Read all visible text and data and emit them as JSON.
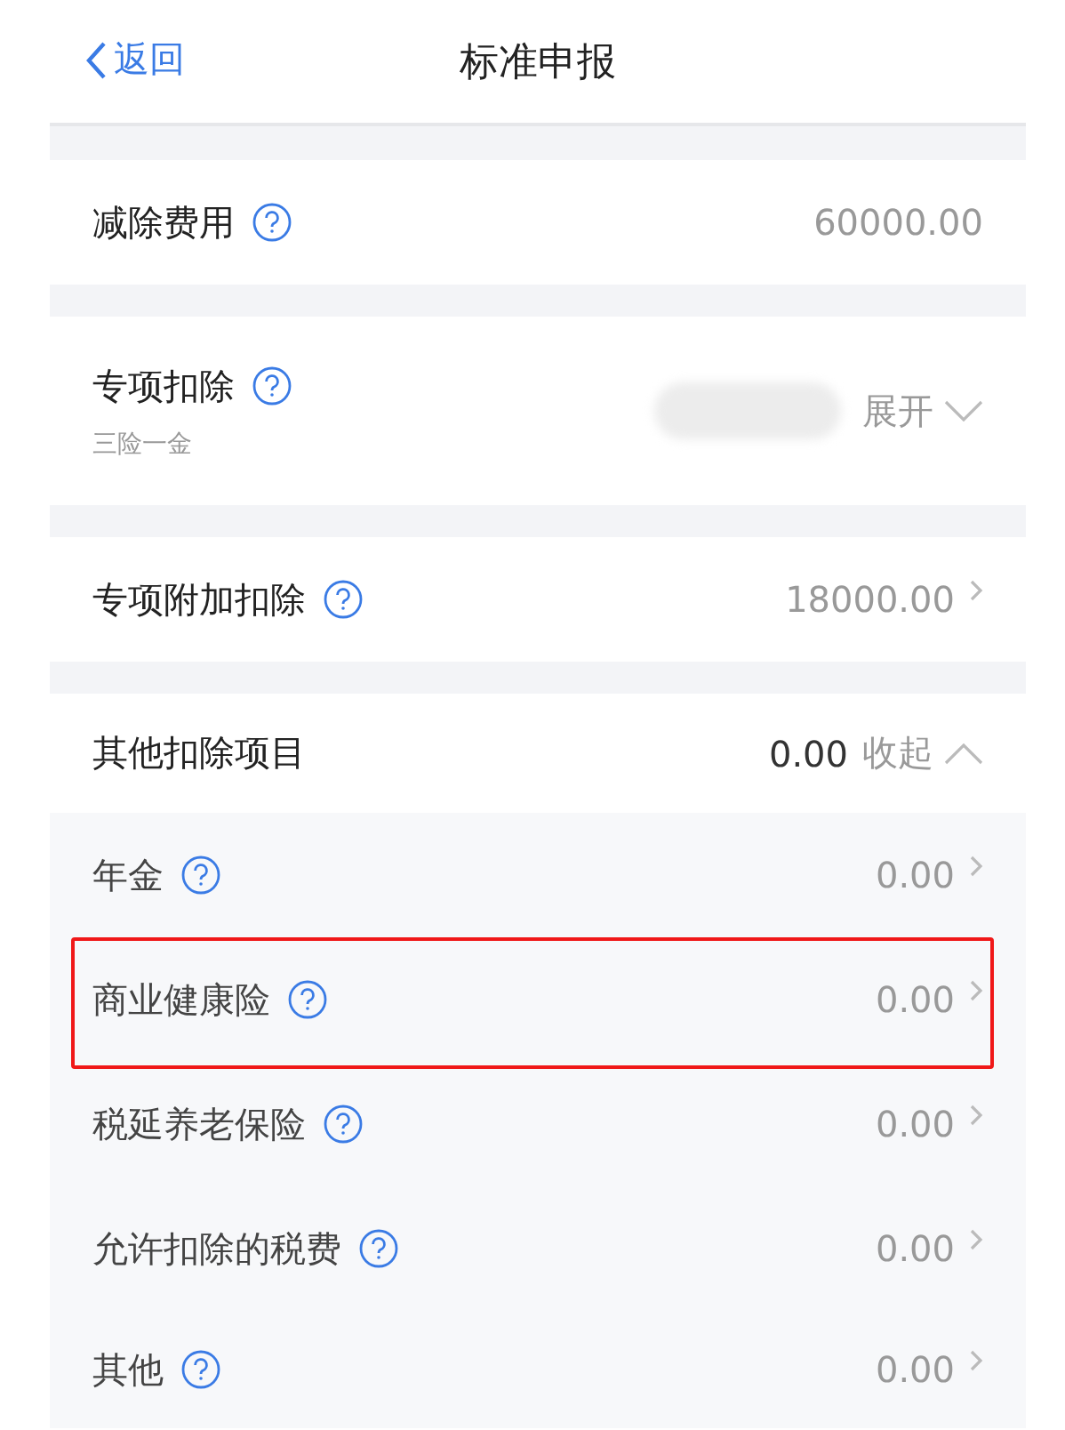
{
  "header": {
    "back": "返回",
    "title": "标准申报"
  },
  "sections": [
    {
      "kind": "value",
      "label": "减除费用",
      "help": true,
      "value": "60000.00",
      "arrow": false
    },
    {
      "kind": "toggle",
      "label": "专项扣除",
      "help": true,
      "note": "三险一金",
      "redacted": true,
      "action": "展开",
      "expanded": false
    },
    {
      "kind": "value",
      "label": "专项附加扣除",
      "help": true,
      "value": "18000.00",
      "arrow": true
    },
    {
      "kind": "toggle",
      "label": "其他扣除项目",
      "help": false,
      "value": "0.00",
      "action": "收起",
      "expanded": true,
      "children": [
        {
          "label": "年金",
          "value": "0.00",
          "highlighted": false
        },
        {
          "label": "商业健康险",
          "value": "0.00",
          "highlighted": true
        },
        {
          "label": "税延养老保险",
          "value": "0.00",
          "highlighted": false
        },
        {
          "label": "允许扣除的税费",
          "value": "0.00",
          "highlighted": false
        },
        {
          "label": "其他",
          "value": "0.00",
          "highlighted": false
        }
      ]
    }
  ]
}
